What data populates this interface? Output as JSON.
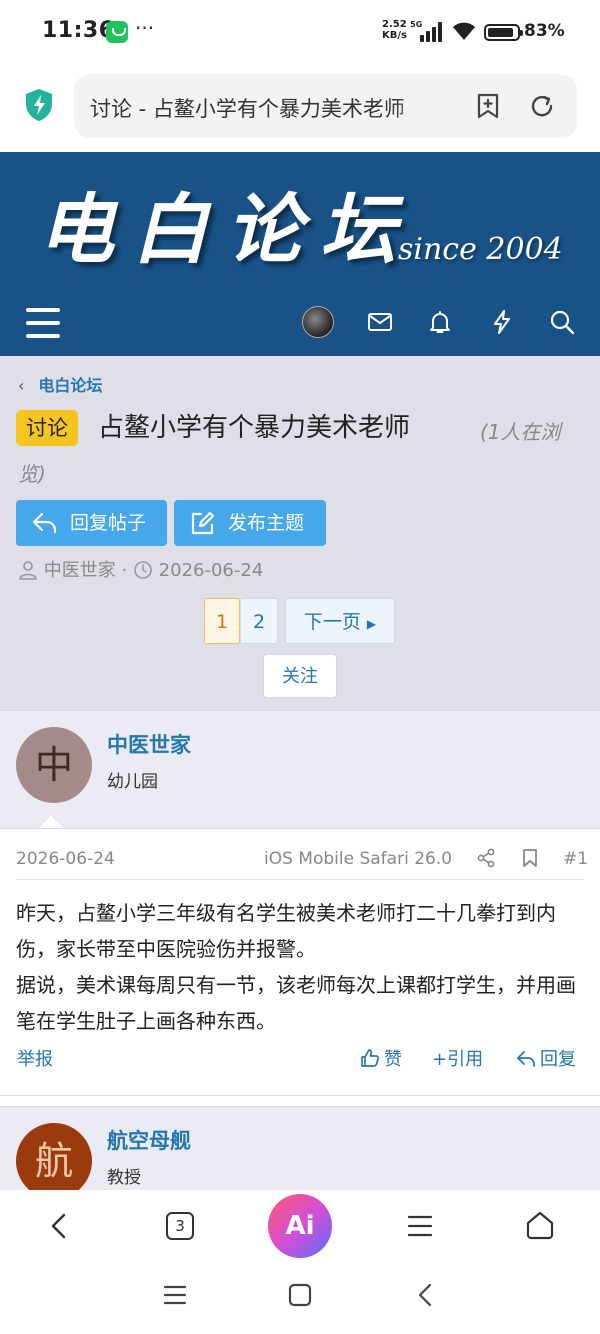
{
  "status_bar": {
    "time": "11:36",
    "dots": "···",
    "speed_value": "2.52",
    "speed_unit": "KB/s",
    "network": "5G",
    "battery": "83%"
  },
  "browser": {
    "url_title": "讨论 - 占鳌小学有个暴力美术老师",
    "tab_count": "3",
    "ai_label": "Ai"
  },
  "forum": {
    "logo_text": "电白论坛",
    "since_text": "since 2004"
  },
  "thread": {
    "breadcrumb": "电白论坛",
    "prefix": "讨论",
    "title": "占鳌小学有个暴力美术老师",
    "viewers_a": "(1人在浏",
    "viewers_b": "览)",
    "reply_button": "回复帖子",
    "post_thread_button": "发布主题",
    "author": "中医世家",
    "separator": "·",
    "date": "2026-06-24",
    "pages": [
      "1",
      "2"
    ],
    "next_page": "下一页",
    "follow": "关注"
  },
  "posts": [
    {
      "avatar_letter": "中",
      "avatar_color": "#a58a8a",
      "avatar_text_color": "#3a2a2a",
      "username": "中医世家",
      "rank": "幼儿园",
      "date": "2026-06-24",
      "user_agent": "iOS Mobile Safari 26.0",
      "number": "#1",
      "content_line1": "昨天，占鳌小学三年级有名学生被美术老师打二十几拳打到内伤，家长带至中医院验伤并报警。",
      "content_line2": "据说，美术课每周只有一节，该老师每次上课都打学生，并用画笔在学生肚子上画各种东西。",
      "report": "举报",
      "like": "赞",
      "quote": "+引用",
      "reply": "回复"
    },
    {
      "avatar_letter": "航",
      "avatar_color": "#9b3a0c",
      "avatar_text_color": "#f3c9a7",
      "username": "航空母舰",
      "rank": "教授"
    }
  ],
  "colors": {
    "header_blue": "#185287",
    "link_blue": "#2577b1",
    "button_blue": "#47a7eb",
    "prefix_yellow": "#f7c520"
  }
}
